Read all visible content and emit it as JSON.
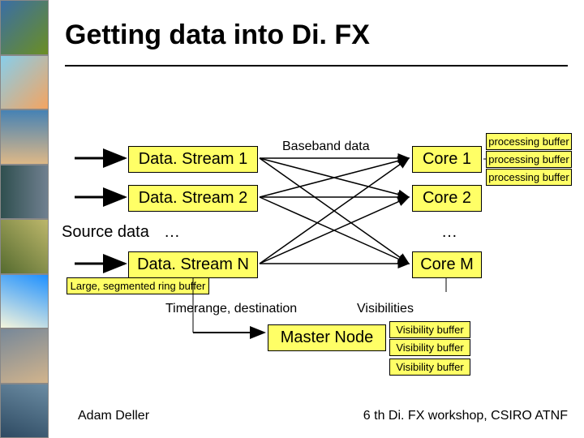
{
  "title": "Getting data into Di. FX",
  "source_label": "Source data",
  "baseband_label": "Baseband data",
  "datastreams": [
    "Data. Stream 1",
    "Data. Stream 2",
    "Data. Stream N"
  ],
  "cores": [
    "Core 1",
    "Core 2",
    "Core M"
  ],
  "ring_buffer_label": "Large, segmented ring buffer",
  "processing_buffer_label": "processing buffer",
  "timerange_label": "Timerange, destination",
  "visibilities_label": "Visibilities",
  "master_node_label": "Master Node",
  "visibility_buffer_label": "Visibility buffer",
  "ellipsis": "…",
  "footer_left": "Adam Deller",
  "footer_right": "6 th Di. FX workshop, CSIRO ATNF"
}
